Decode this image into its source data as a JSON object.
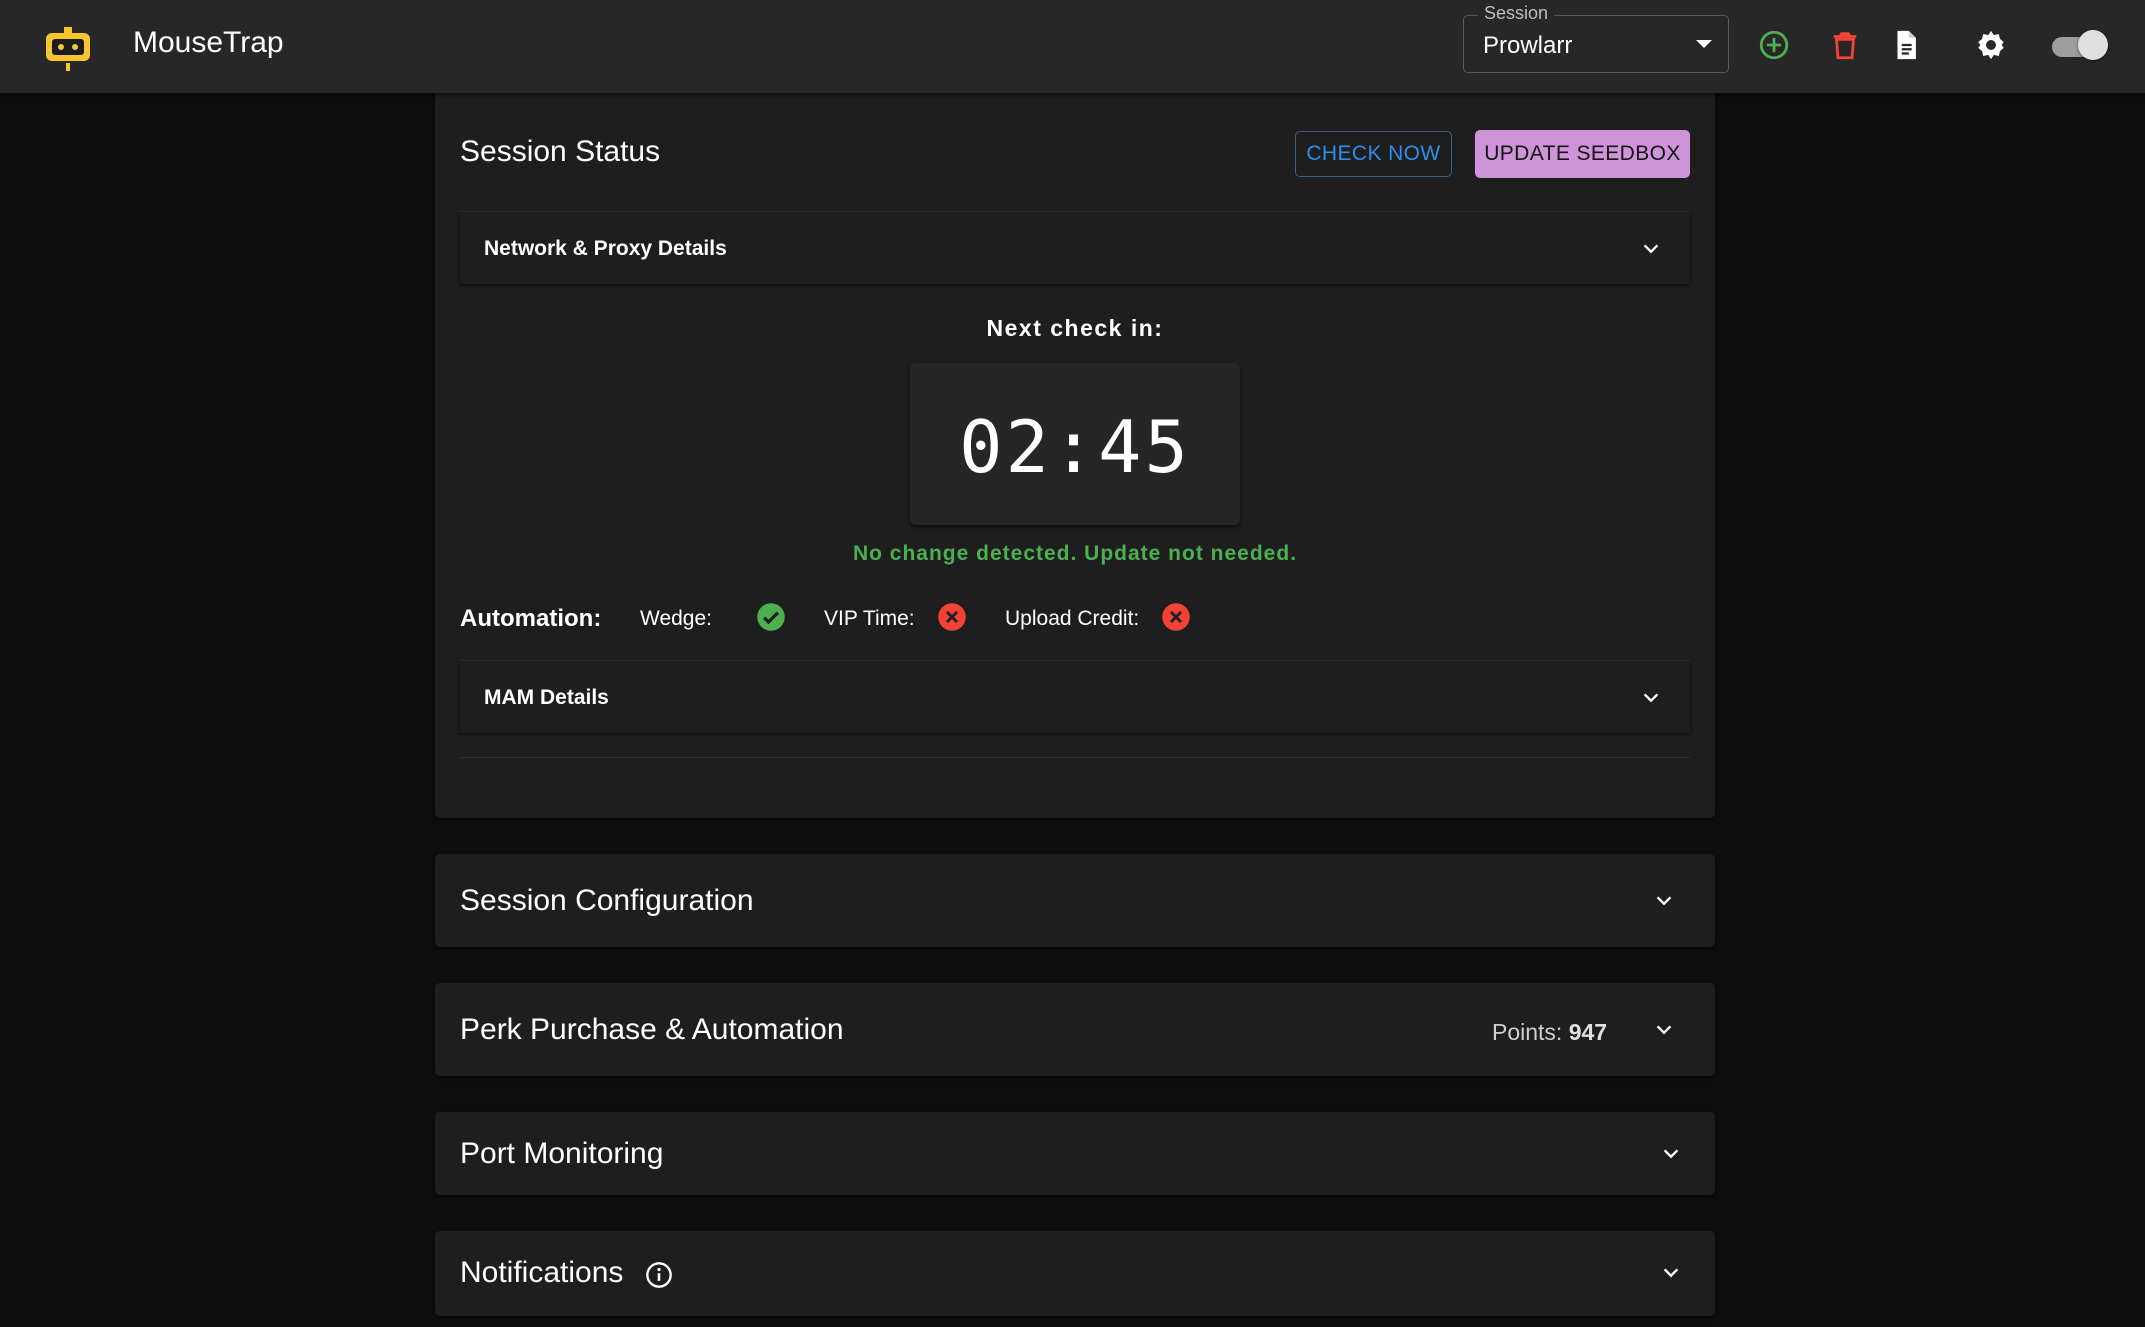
{
  "app": {
    "title": "MouseTrap"
  },
  "toolbar": {
    "session_label": "Session",
    "session_value": "Prowlarr"
  },
  "status": {
    "title": "Session Status",
    "check_now": "CHECK NOW",
    "update_seedbox": "UPDATE SEEDBOX",
    "network_details": "Network & Proxy Details",
    "next_check_label": "Next check in:",
    "timer": "02:45",
    "message": "No change detected. Update not needed.",
    "automation_label": "Automation:",
    "wedge": "Wedge:",
    "vip_time": "VIP Time:",
    "upload_credit": "Upload Credit:",
    "mam_details": "MAM Details"
  },
  "sections": {
    "session_config": "Session Configuration",
    "perk": "Perk Purchase & Automation",
    "points_label": "Points:",
    "points_value": "947",
    "port_monitoring": "Port Monitoring",
    "notifications": "Notifications"
  },
  "colors": {
    "accent_blue": "#2f8ee8",
    "accent_purple": "#ce93d8",
    "success": "#4caf50",
    "error": "#f44336"
  }
}
